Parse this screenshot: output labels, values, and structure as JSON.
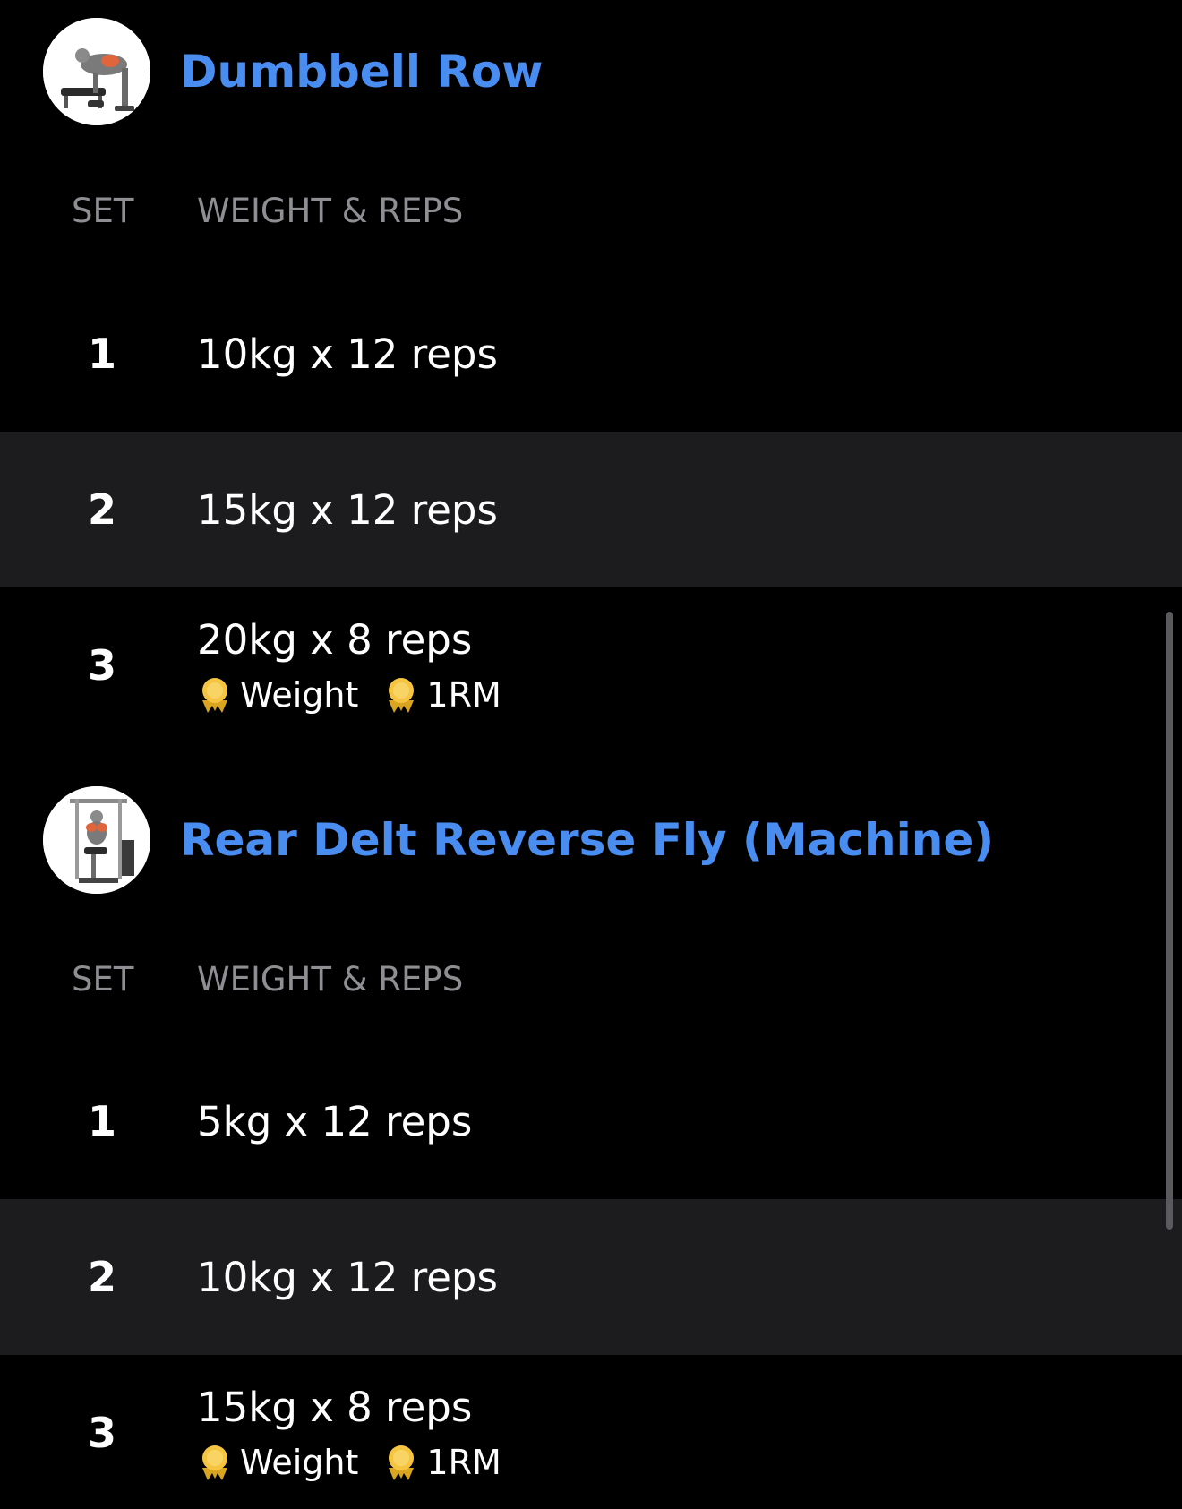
{
  "exercises": [
    {
      "title": "Dumbbell Row",
      "thumbnail_icon": "dumbbell-row-illustration",
      "columns": {
        "set": "SET",
        "weight_reps": "WEIGHT & REPS"
      },
      "sets": [
        {
          "number": "1",
          "value": "10kg x 12 reps"
        },
        {
          "number": "2",
          "value": "15kg x 12 reps"
        },
        {
          "number": "3",
          "value": "20kg x 8 reps",
          "badges": [
            "Weight",
            "1RM"
          ]
        }
      ]
    },
    {
      "title": "Rear Delt Reverse Fly (Machine)",
      "thumbnail_icon": "rear-delt-machine-illustration",
      "columns": {
        "set": "SET",
        "weight_reps": "WEIGHT & REPS"
      },
      "sets": [
        {
          "number": "1",
          "value": "5kg x 12 reps"
        },
        {
          "number": "2",
          "value": "10kg x 12 reps"
        },
        {
          "number": "3",
          "value": "15kg x 8 reps",
          "badges": [
            "Weight",
            "1RM"
          ]
        }
      ]
    }
  ],
  "badge_icon": "medal-icon",
  "colors": {
    "background": "#000000",
    "alt_row": "#1c1c1e",
    "title_accent": "#4a8df0",
    "column_header": "#8e8e93",
    "medal": "#f5c542"
  }
}
